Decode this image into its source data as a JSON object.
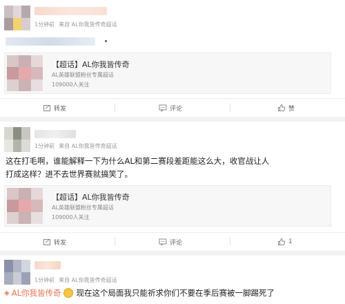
{
  "posts": [
    {
      "meta_time": "1分钟前",
      "meta_source": "来自 AL你我皆传奇超话",
      "card": {
        "title": "【超话】AL你我皆传奇",
        "subtitle": "AL英雄联盟粉丝专属超话",
        "followers": "109000人关注"
      },
      "actions": {
        "repost": "转发",
        "comment": "评论",
        "like": "赞"
      }
    },
    {
      "meta_time": "1分钟前",
      "meta_source": "来自 AL你我皆传奇超话",
      "text_line1": "这在打毛啊，谁能解释一下为什么AL和第二赛段差距能这么大，收官战让人",
      "text_line2": "打成这样？进不去世界赛就搞笑了。",
      "card": {
        "title": "【超话】AL你我皆传奇",
        "subtitle": "AL英雄联盟粉丝专属超话",
        "followers": "109000人关注"
      },
      "actions": {
        "repost": "转发",
        "comment": "评论",
        "like": "1"
      }
    },
    {
      "meta_time": "1分钟前",
      "meta_source": "来自 AL你我皆传奇超话",
      "topic_link": "AL你我皆传奇",
      "text_rest": "现在这个局面我只能祈求你们不要在季后赛被一脚踢死了"
    }
  ],
  "colors": {
    "accent": "#eb7350",
    "meta": "#999999",
    "background": "#f2f2f2"
  }
}
